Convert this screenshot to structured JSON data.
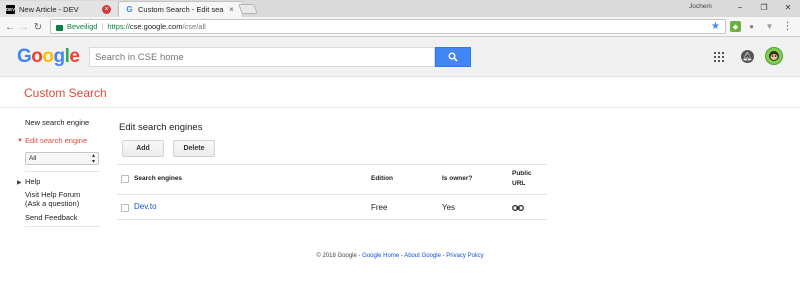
{
  "browser": {
    "tabs": [
      {
        "title": "New Article - DEV",
        "favicon": "DEV",
        "active": false
      },
      {
        "title": "Custom Search - Edit sea",
        "favicon": "G",
        "active": true
      }
    ],
    "user_name": "Jochem",
    "window_controls": {
      "minimize": "−",
      "restore": "❐",
      "close": "✕"
    },
    "address": {
      "secure_label": "Beveiligd",
      "scheme": "https://",
      "host": "cse.google.com",
      "path": "/cse/all"
    }
  },
  "google_header": {
    "logo": [
      "G",
      "o",
      "o",
      "g",
      "l",
      "e"
    ],
    "search_placeholder": "Search in CSE home"
  },
  "cse": {
    "title": "Custom Search"
  },
  "sidebar": {
    "items": [
      {
        "label": "New search engine"
      },
      {
        "label": "Edit search engine"
      },
      {
        "label": "Help"
      },
      {
        "label": "Visit Help Forum"
      },
      {
        "label": "(Ask a question)"
      },
      {
        "label": "Send Feedback"
      }
    ],
    "select_value": "All"
  },
  "main": {
    "title": "Edit search engines",
    "buttons": {
      "add": "Add",
      "delete": "Delete"
    },
    "table": {
      "headers": {
        "engines": "Search engines",
        "edition": "Edition",
        "owner": "Is owner?",
        "public_url_1": "Public",
        "public_url_2": "URL"
      },
      "rows": [
        {
          "name": "Dev.to",
          "edition": "Free",
          "owner": "Yes"
        }
      ]
    }
  },
  "footer": {
    "copyright": "© 2018 Google",
    "dash": " - ",
    "links": [
      "Google Home",
      "About Google",
      "Privacy Policy"
    ]
  },
  "colors": {
    "accent_red": "#dd4b39",
    "link_blue": "#1155cc",
    "google_blue": "#4285f4",
    "secure_green": "#0b8043"
  }
}
